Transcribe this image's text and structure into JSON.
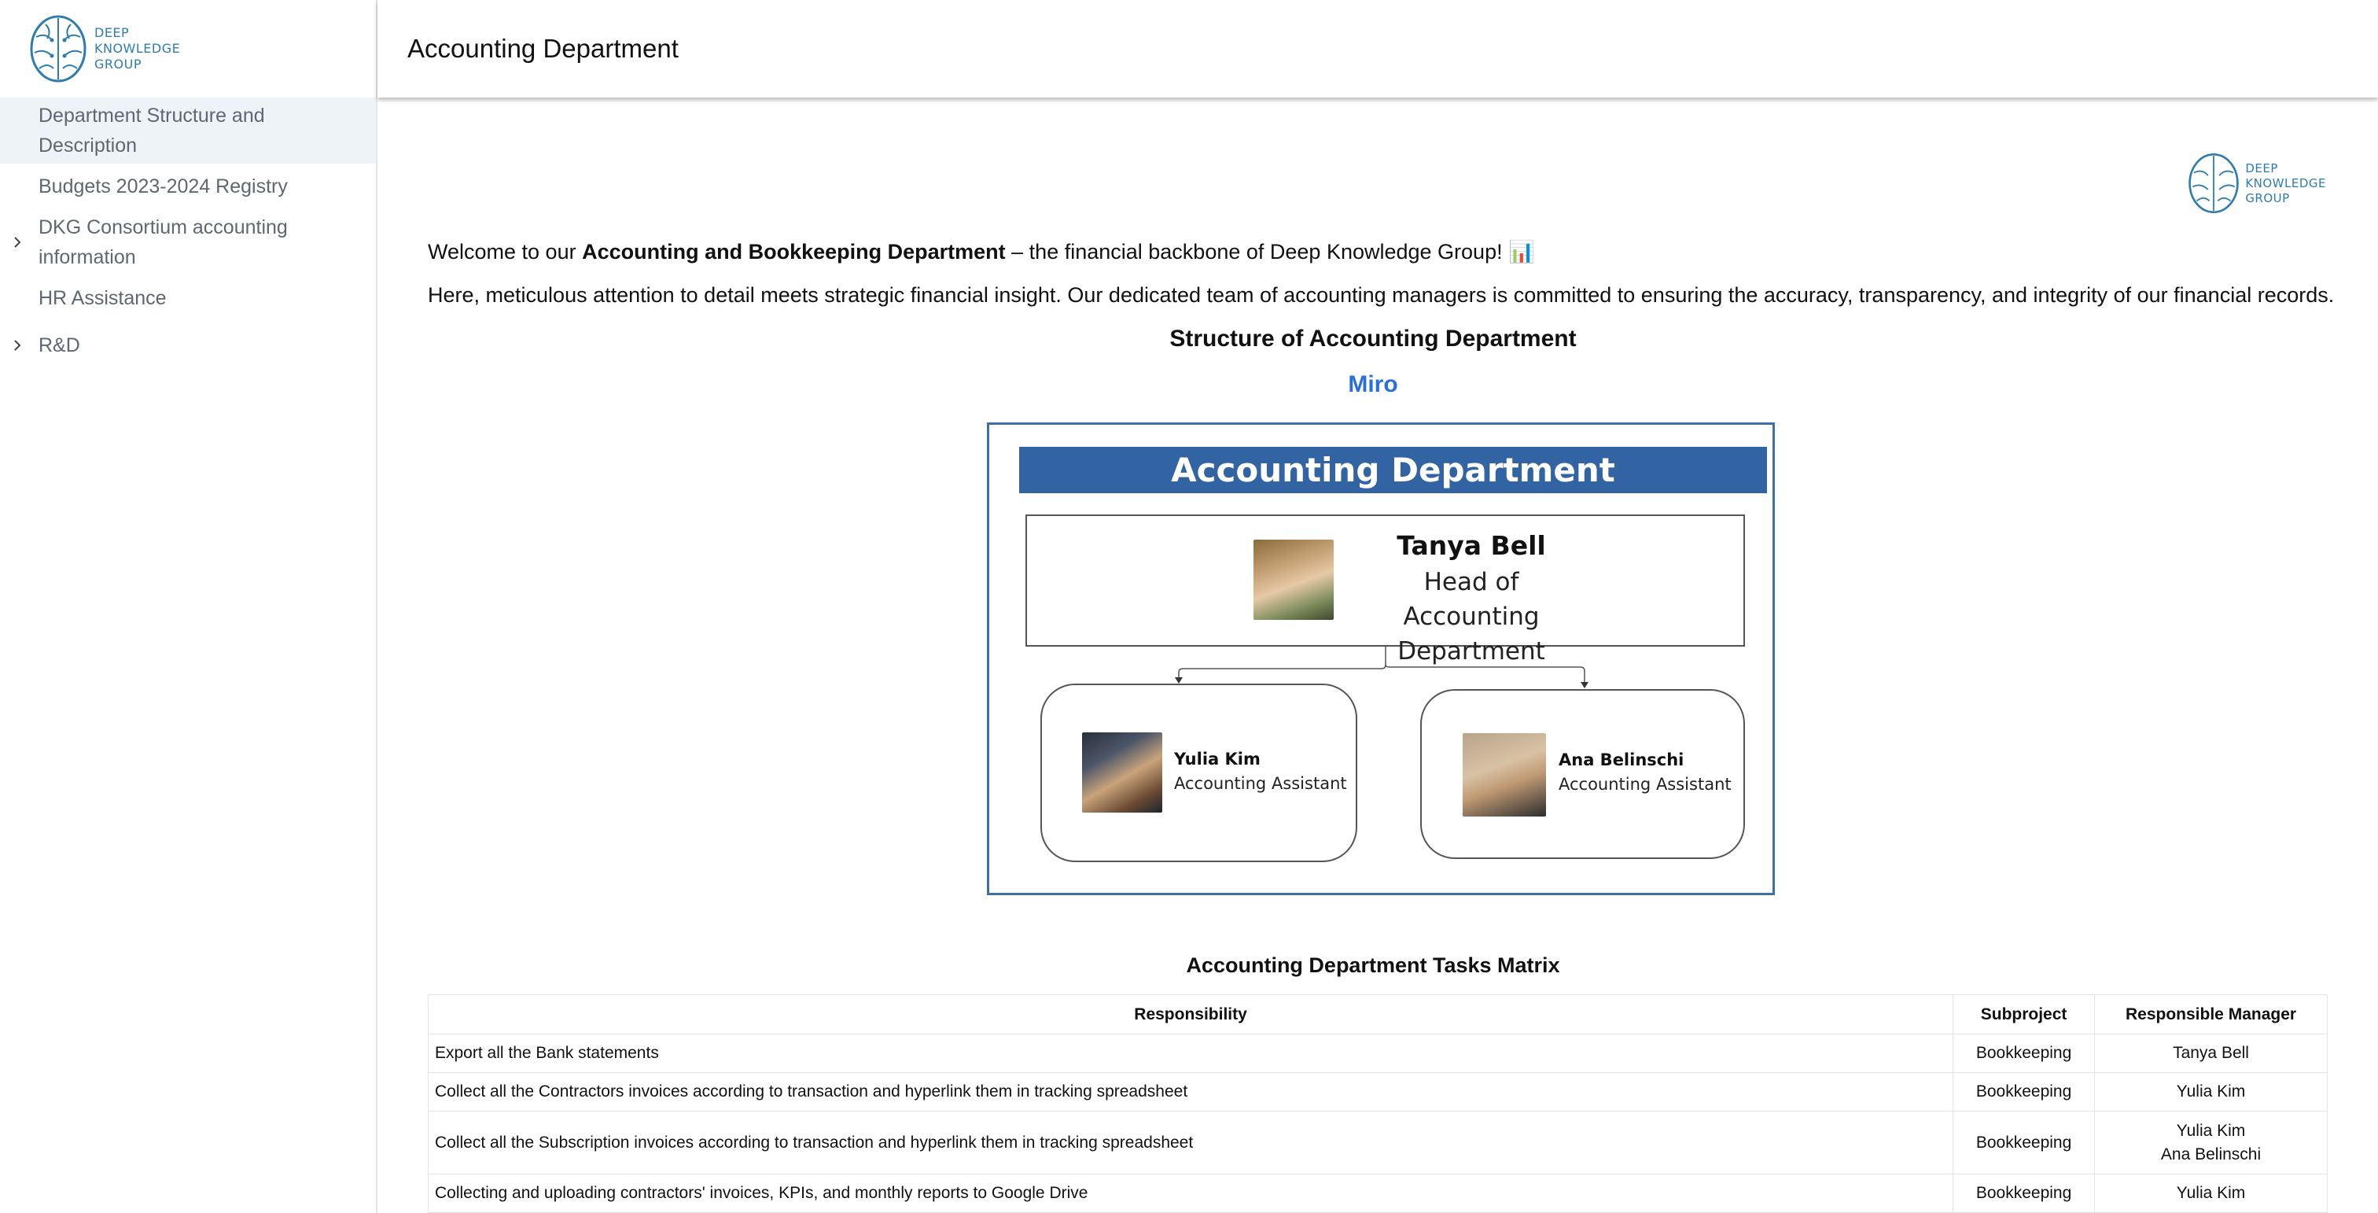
{
  "brand": {
    "logo_lines": [
      "DEEP",
      "KNOWLEDGE",
      "GROUP"
    ],
    "color": "#2f7cae"
  },
  "sidebar": {
    "items": [
      {
        "label": "Department Structure and Description",
        "active": true,
        "expandable": false
      },
      {
        "label": "Budgets 2023-2024 Registry",
        "active": false,
        "expandable": false
      },
      {
        "label": "DKG Consortium accounting information",
        "active": false,
        "expandable": true
      },
      {
        "label": "HR Assistance",
        "active": false,
        "expandable": false
      },
      {
        "label": "R&D",
        "active": false,
        "expandable": true
      }
    ]
  },
  "header": {
    "title": "Accounting Department"
  },
  "content": {
    "intro": {
      "prefix": "Welcome to our ",
      "bold": "Accounting and Bookkeeping Department",
      "suffix": " – the financial backbone of Deep Knowledge Group! 📊"
    },
    "description": "Here, meticulous attention to detail meets strategic financial insight. Our dedicated team of accounting managers is committed to ensuring the accuracy, transparency, and integrity of our financial records.",
    "structure_title": "Structure of Accounting Department",
    "miro_link": "Miro",
    "org_chart": {
      "banner": "Accounting Department",
      "head": {
        "name": "Tanya Bell",
        "role_lines": [
          "Head of Accounting",
          "Department"
        ]
      },
      "assistants": [
        {
          "name": "Yulia Kim",
          "role": "Accounting Assistant"
        },
        {
          "name": "Ana Belinschi",
          "role": "Accounting Assistant"
        }
      ]
    },
    "matrix_title": "Accounting Department Tasks Matrix",
    "table": {
      "headers": [
        "Responsibility",
        "Subproject",
        "Responsible Manager"
      ],
      "rows": [
        {
          "responsibility": "Export all the Bank statements",
          "subproject": "Bookkeeping",
          "managers": [
            "Tanya Bell"
          ]
        },
        {
          "responsibility": "Collect all the Contractors invoices according to transaction and hyperlink them in tracking spreadsheet",
          "subproject": "Bookkeeping",
          "managers": [
            "Yulia Kim"
          ]
        },
        {
          "responsibility": "Collect all the Subscription invoices according to transaction and hyperlink them in tracking spreadsheet",
          "subproject": "Bookkeeping",
          "managers": [
            "Yulia Kim",
            "Ana Belinschi"
          ]
        },
        {
          "responsibility": "Collecting and uploading contractors' invoices, KPIs, and monthly reports to Google Drive",
          "subproject": "Bookkeeping",
          "managers": [
            "Yulia Kim"
          ]
        }
      ]
    }
  }
}
